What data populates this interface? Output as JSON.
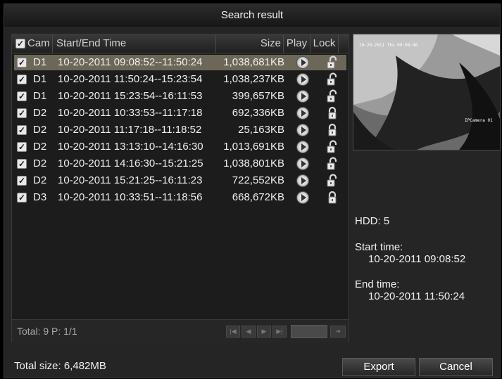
{
  "dialog": {
    "title": "Search result"
  },
  "table": {
    "headers": {
      "cam": "Cam",
      "time": "Start/End Time",
      "size": "Size",
      "play": "Play",
      "lock": "Lock"
    },
    "rows": [
      {
        "cam": "D1",
        "time": "10-20-2011 09:08:52--11:50:24",
        "size": "1,038,681KB",
        "locked": false,
        "selected": true
      },
      {
        "cam": "D1",
        "time": "10-20-2011 11:50:24--15:23:54",
        "size": "1,038,237KB",
        "locked": false,
        "selected": false
      },
      {
        "cam": "D1",
        "time": "10-20-2011 15:23:54--16:11:53",
        "size": "399,657KB",
        "locked": false,
        "selected": false
      },
      {
        "cam": "D2",
        "time": "10-20-2011 10:33:53--11:17:18",
        "size": "692,336KB",
        "locked": true,
        "selected": false
      },
      {
        "cam": "D2",
        "time": "10-20-2011 11:17:18--11:18:52",
        "size": "25,163KB",
        "locked": true,
        "selected": false
      },
      {
        "cam": "D2",
        "time": "10-20-2011 13:13:10--14:16:30",
        "size": "1,013,691KB",
        "locked": false,
        "selected": false
      },
      {
        "cam": "D2",
        "time": "10-20-2011 14:16:30--15:21:25",
        "size": "1,038,801KB",
        "locked": false,
        "selected": false
      },
      {
        "cam": "D2",
        "time": "10-20-2011 15:21:25--16:11:23",
        "size": "722,552KB",
        "locked": false,
        "selected": false
      },
      {
        "cam": "D3",
        "time": "10-20-2011 10:33:51--11:18:56",
        "size": "668,672KB",
        "locked": true,
        "selected": false
      }
    ]
  },
  "pagination": {
    "total_label": "Total: 9  P: 1/1"
  },
  "preview": {
    "osd_time": "10-20-2011 Thu 09:08:46",
    "osd_camera": "IPCamera 01"
  },
  "info": {
    "hdd": "HDD: 5",
    "start_label": "Start time:",
    "start_value": "10-20-2011 09:08:52",
    "end_label": "End time:",
    "end_value": "10-20-2011 11:50:24"
  },
  "footer": {
    "total_size": "Total size: 6,482MB",
    "export_label": "Export",
    "cancel_label": "Cancel"
  }
}
